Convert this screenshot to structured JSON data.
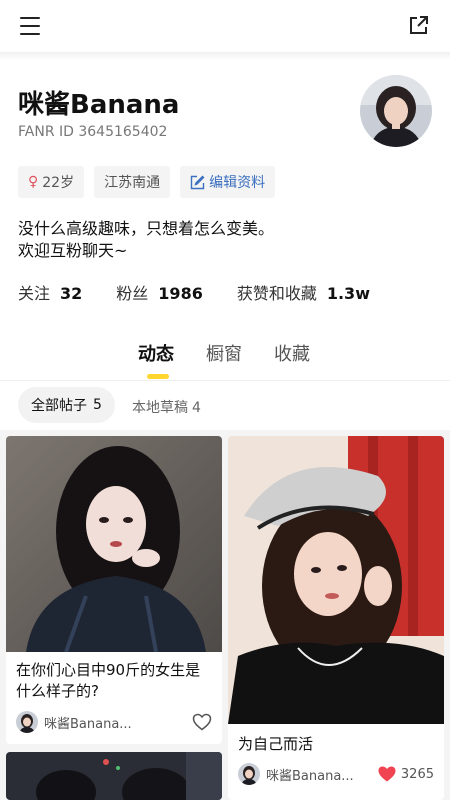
{
  "profile": {
    "name": "咪酱Banana",
    "fanr_id": "FANR ID 3645165402",
    "age_tag": "22岁",
    "location_tag": "江苏南通",
    "edit_label": "编辑资料",
    "bio_line1": "没什么高级趣味，只想着怎么变美。",
    "bio_line2": "欢迎互粉聊天~"
  },
  "stats": {
    "following_label": "关注",
    "following_value": "32",
    "fans_label": "粉丝",
    "fans_value": "1986",
    "likes_label": "获赞和收藏",
    "likes_value": "1.3w"
  },
  "tabs": {
    "posts": "动态",
    "showcase": "橱窗",
    "favorites": "收藏"
  },
  "subtabs": {
    "all_posts": "全部帖子",
    "all_posts_count": "5",
    "drafts": "本地草稿",
    "drafts_count": "4"
  },
  "cards": [
    {
      "title": "在你们心目中90斤的女生是什么样子的?",
      "author": "咪酱Banana...",
      "likes": ""
    },
    {
      "title": "为自己而活",
      "author": "咪酱Banana...",
      "likes": "3265"
    }
  ],
  "colors": {
    "accent": "#ffd52e",
    "edit_blue": "#3b6fbf",
    "heart_red": "#f04452",
    "gender_pink": "#e0525d"
  },
  "icons": {
    "menu": "menu-icon",
    "share": "share-icon",
    "edit": "edit-icon",
    "gender": "female-icon",
    "heart": "heart-icon"
  }
}
